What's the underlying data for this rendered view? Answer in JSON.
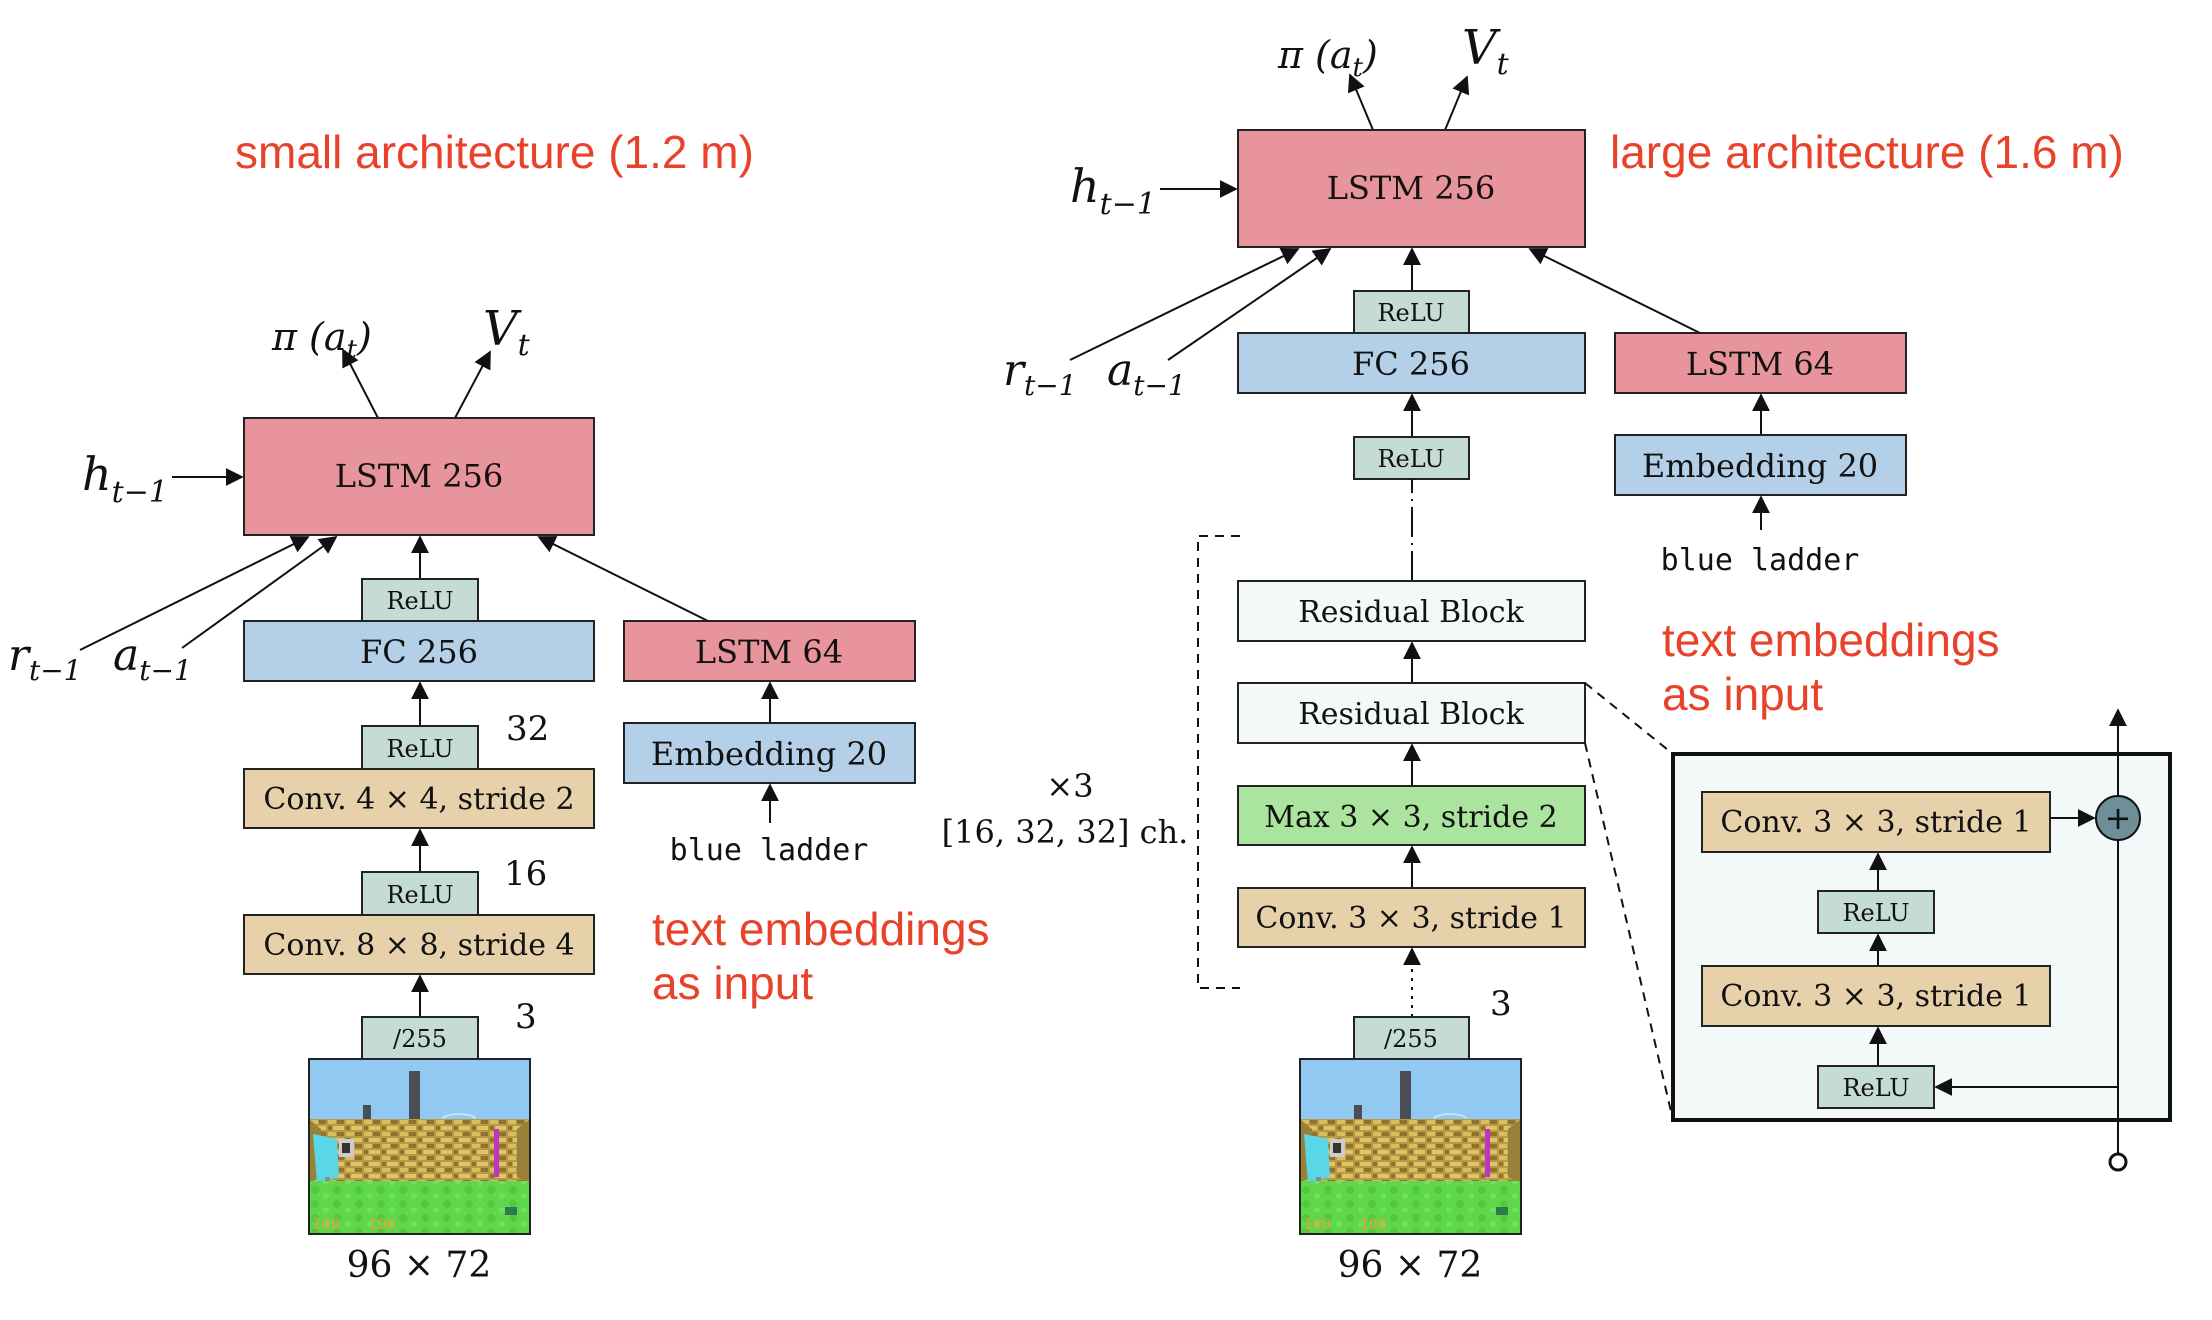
{
  "colors": {
    "lstm": "#e8949c",
    "fc": "#b3d0e8",
    "relu": "#c5dbd6",
    "conv": "#e6d1ab",
    "maxpool": "#abe49e",
    "residual": "#f3f9f9",
    "inset_bg": "#f3f9f9",
    "plus_node": "#6f8f98",
    "annotation": "#e8432a",
    "stroke": "#222222"
  },
  "small": {
    "title": "small architecture (1.2 m)",
    "outputs": {
      "policy": "π (a",
      "policy_sub": "t",
      "policy_close": ")",
      "value": "V",
      "value_sub": "t"
    },
    "inputs": {
      "h": "h",
      "h_sub": "t−1",
      "r": "r",
      "r_sub": "t−1",
      "a": "a",
      "a_sub": "t−1"
    },
    "lstm_main": "LSTM 256",
    "relu_fc": "ReLU",
    "fc": "FC 256",
    "relu_conv2": "ReLU",
    "channels_conv2": "32",
    "conv2": "Conv. 4 × 4, stride 2",
    "relu_conv1": "ReLU",
    "channels_conv1": "16",
    "conv1": "Conv. 8 × 8, stride 4",
    "normalize": "/255",
    "channels_input": "3",
    "input_size": "96 × 72",
    "lstm_text": "LSTM 64",
    "embedding": "Embedding 20",
    "text_input": "blue ladder",
    "annotation_line1": "text embeddings",
    "annotation_line2": "as input"
  },
  "large": {
    "title": "large architecture (1.6 m)",
    "outputs": {
      "policy": "π (a",
      "policy_sub": "t",
      "policy_close": ")",
      "value": "V",
      "value_sub": "t"
    },
    "inputs": {
      "h": "h",
      "h_sub": "t−1",
      "r": "r",
      "r_sub": "t−1",
      "a": "a",
      "a_sub": "t−1"
    },
    "lstm_main": "LSTM 256",
    "relu_fc": "ReLU",
    "fc": "FC 256",
    "relu_res": "ReLU",
    "res_block_top": "Residual Block",
    "res_block_bottom": "Residual Block",
    "maxpool": "Max 3 × 3, stride 2",
    "conv": "Conv. 3 × 3, stride 1",
    "repeat": "×3",
    "repeat_channels": "[16, 32, 32] ch.",
    "normalize": "/255",
    "channels_input": "3",
    "input_size": "96 × 72",
    "lstm_text": "LSTM 64",
    "embedding": "Embedding 20",
    "text_input": "blue ladder",
    "annotation_line1": "text embeddings",
    "annotation_line2": "as input",
    "residual_detail": {
      "conv_top": "Conv. 3 × 3, stride 1",
      "relu_mid": "ReLU",
      "conv_bottom": "Conv. 3 × 3, stride 1",
      "relu_bottom": "ReLU",
      "plus": "+"
    }
  },
  "game_frame": {
    "hud_left": "100",
    "hud_right": "100"
  }
}
